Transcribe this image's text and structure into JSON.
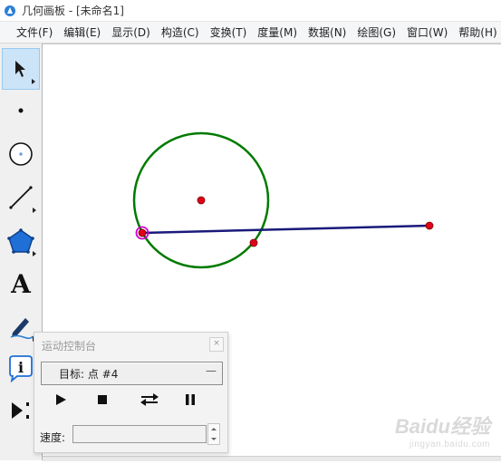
{
  "window": {
    "title": "几何画板 - [未命名1]"
  },
  "menu": {
    "items": [
      {
        "label": "文件(F)"
      },
      {
        "label": "编辑(E)"
      },
      {
        "label": "显示(D)"
      },
      {
        "label": "构造(C)"
      },
      {
        "label": "变换(T)"
      },
      {
        "label": "度量(M)"
      },
      {
        "label": "数据(N)"
      },
      {
        "label": "绘图(G)"
      },
      {
        "label": "窗口(W)"
      },
      {
        "label": "帮助(H)"
      }
    ]
  },
  "toolbox": {
    "tools": [
      {
        "name": "arrow-selection-tool",
        "icon": "arrow-icon",
        "selected": true
      },
      {
        "name": "point-tool",
        "icon": "point-icon"
      },
      {
        "name": "compass-tool",
        "icon": "compass-circle-icon"
      },
      {
        "name": "straightedge-tool",
        "icon": "line-segment-icon"
      },
      {
        "name": "polygon-tool",
        "icon": "pentagon-icon"
      },
      {
        "name": "text-tool",
        "icon": "text-A-icon",
        "glyph": "A"
      },
      {
        "name": "marker-tool",
        "icon": "marker-pen-icon"
      },
      {
        "name": "information-tool",
        "icon": "info-icon",
        "glyph": "i"
      },
      {
        "name": "custom-tool",
        "icon": "custom-tools-icon"
      }
    ]
  },
  "canvas": {
    "circle_color": "#007a00",
    "segment_color": "#1a1a7a",
    "point_color": "#e0001a",
    "selected_point_ring": "#cc00cc"
  },
  "motion_controller": {
    "title": "运动控制台",
    "target_label": "目标: 点 #4",
    "target_dropdown_symbol": "—",
    "speed_label": "速度:",
    "speed_value": "",
    "buttons": [
      {
        "name": "play-button",
        "icon": "play-icon"
      },
      {
        "name": "stop-button",
        "icon": "stop-icon"
      },
      {
        "name": "reverse-button",
        "icon": "reverse-direction-icon"
      },
      {
        "name": "pause-button",
        "icon": "pause-icon"
      }
    ]
  },
  "watermark": {
    "main": "Baidu经验",
    "sub": "jingyan.baidu.com"
  }
}
